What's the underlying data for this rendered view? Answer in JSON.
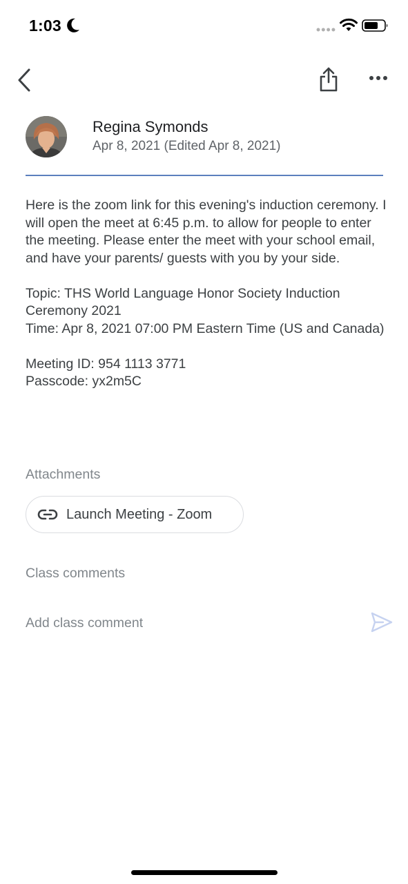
{
  "status_bar": {
    "time": "1:03",
    "icons": [
      "moon-icon",
      "signal-icon",
      "wifi-icon",
      "battery-icon"
    ]
  },
  "toolbar": {
    "icons": [
      "back-arrow-icon",
      "share-icon",
      "more-horizontal-icon"
    ]
  },
  "post": {
    "author": "Regina Symonds",
    "date": "Apr 8, 2021 (Edited Apr 8, 2021)",
    "body": {
      "paragraph_1": "Here is the zoom link for this evening's induction ceremony.  I will open the meet at 6:45 p.m. to allow for people to enter the meeting. Please enter the meet with your school email,  and have your parents/ guests with you by your side.",
      "paragraph_2": "Topic: THS World Language Honor Society Induction Ceremony 2021\nTime: Apr 8, 2021 07:00 PM Eastern Time (US and Canada)",
      "paragraph_3": "Meeting ID: 954 1113 3771\nPasscode: yx2m5C"
    }
  },
  "attachments": {
    "label": "Attachments",
    "items": [
      {
        "label": "Launch Meeting - Zoom",
        "icon": "link-icon"
      }
    ]
  },
  "comments": {
    "label": "Class comments",
    "placeholder": "Add class comment",
    "send_icon": "send-icon"
  },
  "colors": {
    "divider": "#5b7fbd",
    "send_icon": "#c6d2f0",
    "secondary_text": "#80868b",
    "body_text": "#3c4043"
  }
}
